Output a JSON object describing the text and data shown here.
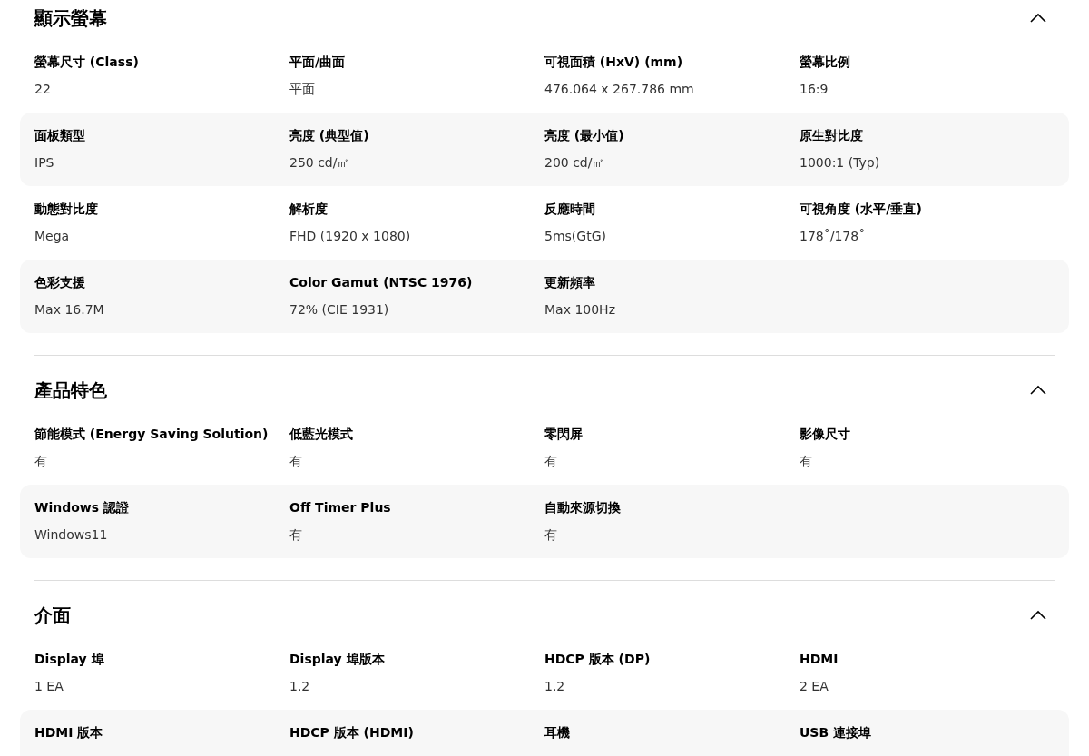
{
  "sections": [
    {
      "title": "顯示螢幕",
      "expanded": true,
      "specs": [
        {
          "label": "螢幕尺寸 (Class)",
          "value": "22"
        },
        {
          "label": "平面/曲面",
          "value": "平面"
        },
        {
          "label": "可視面積 (HxV) (mm)",
          "value": "476.064 x 267.786 mm"
        },
        {
          "label": "螢幕比例",
          "value": "16:9"
        },
        {
          "label": "面板類型",
          "value": "IPS"
        },
        {
          "label": "亮度 (典型值)",
          "value": "250 cd/㎡"
        },
        {
          "label": "亮度 (最小值)",
          "value": "200 cd/㎡"
        },
        {
          "label": "原生對比度",
          "value": "1000:1 (Typ)"
        },
        {
          "label": "動態對比度",
          "value": "Mega"
        },
        {
          "label": "解析度",
          "value": "FHD (1920 x 1080)"
        },
        {
          "label": "反應時間",
          "value": "5ms(GtG)"
        },
        {
          "label": "可視角度 (水平/垂直)",
          "value": "178˚/178˚"
        },
        {
          "label": "色彩支援",
          "value": "Max 16.7M"
        },
        {
          "label": "Color Gamut (NTSC 1976)",
          "value": "72% (CIE 1931)"
        },
        {
          "label": "更新頻率",
          "value": "Max 100Hz"
        }
      ]
    },
    {
      "title": "產品特色",
      "expanded": true,
      "specs": [
        {
          "label": "節能模式 (Energy Saving Solution)",
          "value": "有"
        },
        {
          "label": "低藍光模式",
          "value": "有"
        },
        {
          "label": "零閃屏",
          "value": "有"
        },
        {
          "label": "影像尺寸",
          "value": "有"
        },
        {
          "label": "Windows 認證",
          "value": "Windows11"
        },
        {
          "label": "Off Timer Plus",
          "value": "有"
        },
        {
          "label": "自動來源切換",
          "value": "有"
        }
      ]
    },
    {
      "title": "介面",
      "expanded": true,
      "specs": [
        {
          "label": "Display 埠",
          "value": "1 EA"
        },
        {
          "label": "Display 埠版本",
          "value": "1.2"
        },
        {
          "label": "HDCP 版本 (DP)",
          "value": "1.2"
        },
        {
          "label": "HDMI",
          "value": "2 EA"
        },
        {
          "label": "HDMI 版本"
        },
        {
          "label": "HDCP 版本 (HDMI)"
        },
        {
          "label": "耳機"
        },
        {
          "label": "USB 連接埠"
        }
      ]
    }
  ]
}
